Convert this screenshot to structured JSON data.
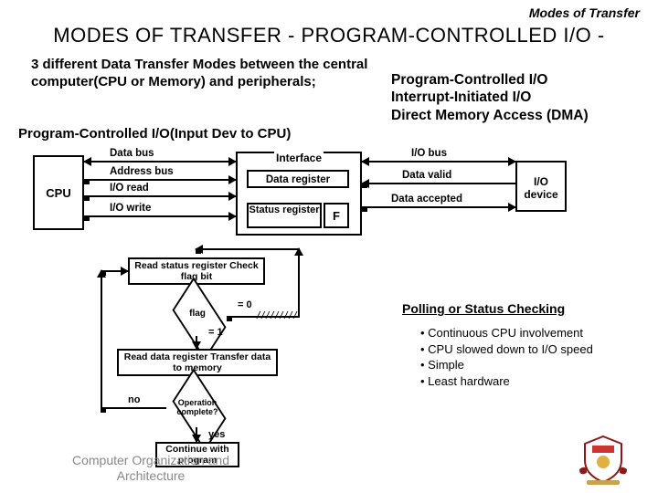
{
  "header": {
    "right": "Modes of Transfer"
  },
  "title": "MODES  OF  TRANSFER - PROGRAM-CONTROLLED  I/O -",
  "intro": "3 different Data Transfer Modes between the central computer(CPU or Memory)  and peripherals;",
  "modes": {
    "m1": "Program-Controlled I/O",
    "m2": "Interrupt-Initiated I/O",
    "m3": "Direct Memory Access (DMA)"
  },
  "subheading": "Program-Controlled I/O(Input Dev to CPU)",
  "diagram": {
    "cpu": "CPU",
    "data_bus": "Data bus",
    "address_bus": "Address bus",
    "io_read": "I/O read",
    "io_write": "I/O write",
    "interface": "Interface",
    "data_register": "Data register",
    "status_register": "Status register",
    "flag": "F",
    "io_bus": "I/O bus",
    "data_valid": "Data valid",
    "data_accepted": "Data accepted",
    "io_device": "I/O device"
  },
  "flowchart": {
    "read_status": "Read status register Check flag bit",
    "flag": "flag",
    "eq0": "= 0",
    "eq1": "= 1",
    "read_data": "Read data register Transfer data to memory",
    "op_complete": "Operation complete?",
    "no": "no",
    "yes": "yes",
    "continue": "Continue with program"
  },
  "polling": {
    "title": "Polling or Status Checking",
    "b1": "• Continuous CPU involvement",
    "b2": "• CPU slowed down to I/O speed",
    "b3": "• Simple",
    "b4": "• Least hardware"
  },
  "footer": "Computer Organization and Architecture"
}
